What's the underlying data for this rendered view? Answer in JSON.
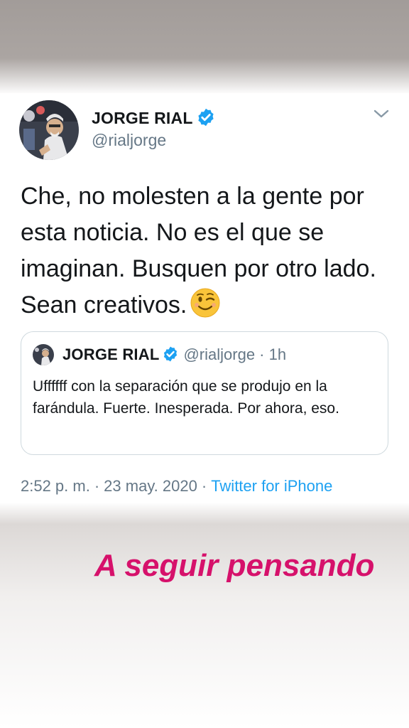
{
  "tweet": {
    "display_name": "JORGE RIAL",
    "handle": "@rialjorge",
    "text": "Che, no molesten a la gente por esta noticia.  No es el que se imaginan. Busquen por otro lado. Sean creativos.",
    "emoji": "winking-face",
    "timestamp": "2:52 p. m.",
    "date": "23 may. 2020",
    "separator": "·",
    "source": "Twitter for iPhone"
  },
  "quoted_tweet": {
    "display_name": "JORGE RIAL",
    "handle_time": "@rialjorge · 1h",
    "text": "Uffffff con la separación que se produjo en la farándula. Fuerte. Inesperada. Por ahora, eso."
  },
  "caption": "A seguir pensando",
  "colors": {
    "verified": "#1da1f2",
    "link": "#1da1f2",
    "secondary_text": "#657786",
    "caption": "#d6116b",
    "background_top": "#a29c99"
  },
  "icons": {
    "verified": "verified-badge-icon",
    "menu": "chevron-down-icon",
    "emoji": "winking-face-icon"
  }
}
